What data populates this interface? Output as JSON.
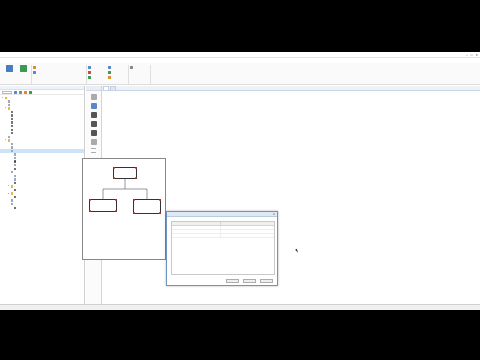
{
  "window": {
    "title": "",
    "controls": [
      "–",
      "□",
      "✕"
    ]
  },
  "menu": {
    "items": [
      "",
      "",
      "",
      "",
      "",
      "",
      "",
      "",
      "",
      ""
    ],
    "active_index": 5
  },
  "ribbon": {
    "big_button_label": "",
    "big_button_label2": "",
    "group1": [
      "",
      ""
    ],
    "group2": [
      "",
      "",
      ""
    ],
    "group3": [
      "",
      "",
      ""
    ],
    "group4_label": "",
    "group_names": [
      "",
      "",
      "",
      ""
    ]
  },
  "left_panel": {
    "header": "",
    "tree": [
      {
        "level": 0,
        "icon": "fold",
        "label": ""
      },
      {
        "level": 1,
        "icon": "doc",
        "label": ""
      },
      {
        "level": 1,
        "icon": "doc",
        "label": ""
      },
      {
        "level": 1,
        "icon": "fold",
        "label": ""
      },
      {
        "level": 2,
        "icon": "chk",
        "label": ""
      },
      {
        "level": 2,
        "icon": "chk",
        "label": ""
      },
      {
        "level": 2,
        "icon": "chk",
        "label": ""
      },
      {
        "level": 2,
        "icon": "chk",
        "label": ""
      },
      {
        "level": 2,
        "icon": "chk",
        "label": ""
      },
      {
        "level": 2,
        "icon": "chk",
        "label": ""
      },
      {
        "level": 2,
        "icon": "chk",
        "label": ""
      },
      {
        "level": 1,
        "icon": "doc",
        "label": ""
      },
      {
        "level": 1,
        "icon": "fold",
        "label": ""
      },
      {
        "level": 2,
        "icon": "doc",
        "label": ""
      },
      {
        "level": 2,
        "icon": "doc",
        "label": ""
      },
      {
        "level": 2,
        "icon": "doc",
        "label": "",
        "selected": true
      },
      {
        "level": 3,
        "icon": "doc",
        "label": ""
      },
      {
        "level": 3,
        "icon": "doc",
        "label": ""
      },
      {
        "level": 3,
        "icon": "user",
        "label": ""
      },
      {
        "level": 3,
        "icon": "doc",
        "label": ""
      },
      {
        "level": 3,
        "icon": "user",
        "label": ""
      },
      {
        "level": 2,
        "icon": "doc",
        "label": ""
      },
      {
        "level": 3,
        "icon": "doc",
        "label": ""
      },
      {
        "level": 3,
        "icon": "doc",
        "label": ""
      },
      {
        "level": 3,
        "icon": "user",
        "label": ""
      },
      {
        "level": 2,
        "icon": "fold",
        "label": ""
      },
      {
        "level": 3,
        "icon": "user",
        "label": ""
      },
      {
        "level": 2,
        "icon": "fold",
        "label": ""
      },
      {
        "level": 3,
        "icon": "user",
        "label": ""
      },
      {
        "level": 2,
        "icon": "doc",
        "label": ""
      },
      {
        "level": 2,
        "icon": "doc",
        "label": ""
      },
      {
        "level": 3,
        "icon": "user",
        "label": ""
      }
    ]
  },
  "vertical_toolbar": {
    "tab_label": "",
    "section_label": ""
  },
  "main": {
    "tabs": [
      "",
      ""
    ],
    "subheader": "",
    "diagram": {
      "title": "",
      "nodes": [
        {
          "text": ""
        },
        {
          "text": ""
        },
        {
          "text": ""
        }
      ]
    }
  },
  "dialog": {
    "title": "",
    "columns": [
      "",
      ""
    ],
    "rows": [
      [
        "",
        ""
      ],
      [
        "",
        ""
      ],
      [
        "",
        ""
      ]
    ],
    "buttons": {
      "ok": "",
      "apply": "",
      "cancel": ""
    }
  },
  "status": {
    "left": "",
    "right1": "",
    "right2": ""
  }
}
